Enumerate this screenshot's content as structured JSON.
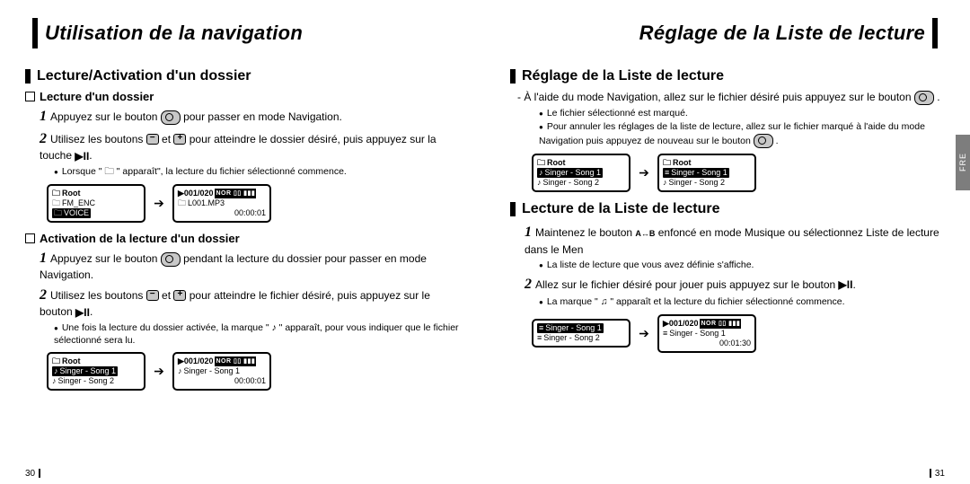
{
  "left": {
    "header": "Utilisation de la navigation",
    "pageNum": "30",
    "h2": "Lecture/Activation d'un dossier",
    "sec1": {
      "h3": "Lecture d'un dossier",
      "step1a": "Appuyez sur le bouton ",
      "step1b": " pour passer en mode Navigation.",
      "step2a": "Utilisez les boutons ",
      "step2b": " et ",
      "step2c": " pour atteindre le dossier désiré, puis appuyez sur la touche ",
      "step2d": ".",
      "note1": "Lorsque \" 🗀 \" apparaît\", la lecture du fichier sélectionné commence.",
      "lcd1": {
        "root": "Root",
        "r1": "FM_ENC",
        "r2": "VOICE"
      },
      "lcd2": {
        "hdr": "001/020",
        "r1": "L001.MP3",
        "t": "00:00:01"
      }
    },
    "sec2": {
      "h3": "Activation de la lecture d'un dossier",
      "step1a": "Appuyez sur le bouton ",
      "step1b": " pendant la lecture du dossier pour passer en mode Navigation.",
      "step2a": "Utilisez les boutons ",
      "step2b": " et ",
      "step2c": " pour atteindre le fichier désiré, puis appuyez sur le bouton ",
      "step2d": ".",
      "note1": "Une fois la lecture du dossier activée, la marque \" ♪ \" apparaît, pour vous indiquer que le fichier sélectionné sera lu.",
      "lcd1": {
        "root": "Root",
        "r1": "Singer - Song 1",
        "r2": "Singer - Song 2"
      },
      "lcd2": {
        "hdr": "001/020",
        "r1": "Singer - Song 1",
        "t": "00:00:01"
      }
    }
  },
  "right": {
    "header": "Réglage de la Liste de lecture",
    "pageNum": "31",
    "tab": "FRE",
    "sec1": {
      "h2": "Réglage de la Liste de lecture",
      "line1a": "- À l'aide du mode Navigation, allez sur le fichier désiré puis appuyez sur le bouton ",
      "line1b": " .",
      "note1": "Le fichier sélectionné est marqué.",
      "note2a": "Pour annuler les réglages de la liste de lecture, allez sur le fichier marqué à l'aide du mode Navigation puis appuyez de nouveau sur le bouton ",
      "note2b": " .",
      "lcd1": {
        "root": "Root",
        "r1": "Singer - Song 1",
        "r2": "Singer - Song 2"
      },
      "lcd2": {
        "root": "Root",
        "r1": "Singer - Song 1",
        "r2": "Singer - Song 2"
      }
    },
    "sec2": {
      "h2": "Lecture de la Liste de lecture",
      "step1a": "Maintenez le bouton ",
      "ab": "A↔B",
      "step1b": " enfoncé en mode Musique ou sélectionnez Liste de lecture dans le Men",
      "note1": "La liste de lecture que vous avez définie s'affiche.",
      "step2a": "Allez sur le fichier désiré pour jouer puis appuyez sur le bouton ",
      "step2b": ".",
      "note2": "La marque \" ♫ \" apparaît et la lecture du fichier sélectionné commence.",
      "lcd1": {
        "r1": "Singer - Song 1",
        "r2": "Singer - Song 2"
      },
      "lcd2": {
        "hdr": "001/020",
        "r1": "Singer - Song 1",
        "t": "00:01:30"
      }
    }
  }
}
